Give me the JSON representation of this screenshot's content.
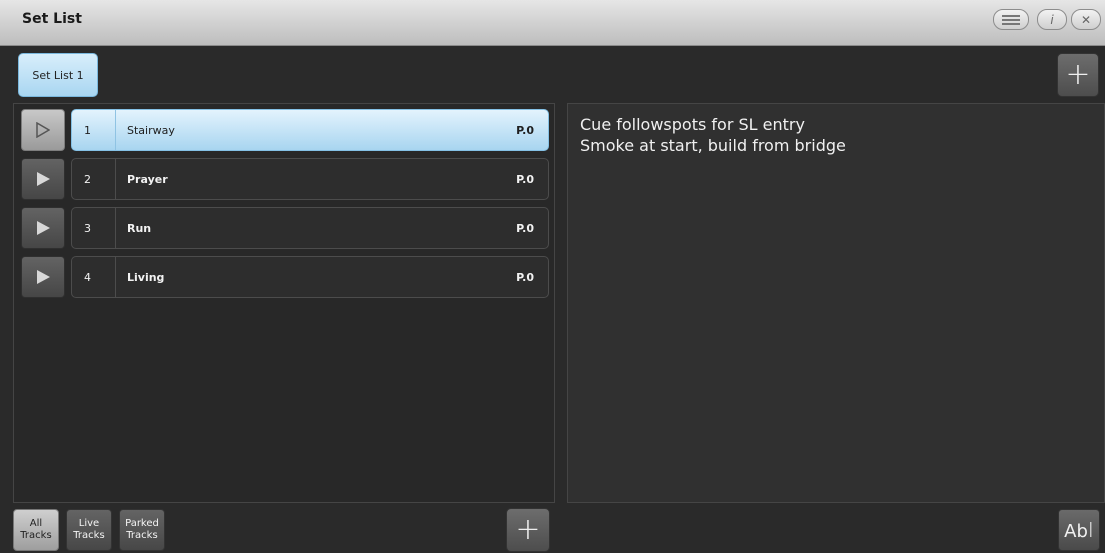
{
  "window": {
    "title": "Set List",
    "buttons": [
      {
        "name": "menu-icon"
      },
      {
        "name": "info-icon",
        "glyph": "i"
      },
      {
        "name": "close-icon",
        "glyph": "✕"
      }
    ]
  },
  "tabs": [
    {
      "label": "Set List 1",
      "selected": true
    }
  ],
  "add_label": "+",
  "tracks": [
    {
      "number": "1",
      "name": "Stairway",
      "position": "P.0",
      "selected": true
    },
    {
      "number": "2",
      "name": "Prayer",
      "position": "P.0",
      "selected": false
    },
    {
      "number": "3",
      "name": "Run",
      "position": "P.0",
      "selected": false
    },
    {
      "number": "4",
      "name": "Living",
      "position": "P.0",
      "selected": false
    }
  ],
  "notes": {
    "line1": "Cue followspots for SL entry",
    "line2": "Smoke at start, build from bridge"
  },
  "filters": [
    {
      "line1": "All",
      "line2": "Tracks",
      "active": true
    },
    {
      "line1": "Live",
      "line2": "Tracks",
      "active": false
    },
    {
      "line1": "Parked",
      "line2": "Tracks",
      "active": false
    }
  ],
  "text_button_label": "Ab",
  "colors": {
    "accent_blue": "#a9d6f1",
    "background": "#2a2a2a"
  }
}
